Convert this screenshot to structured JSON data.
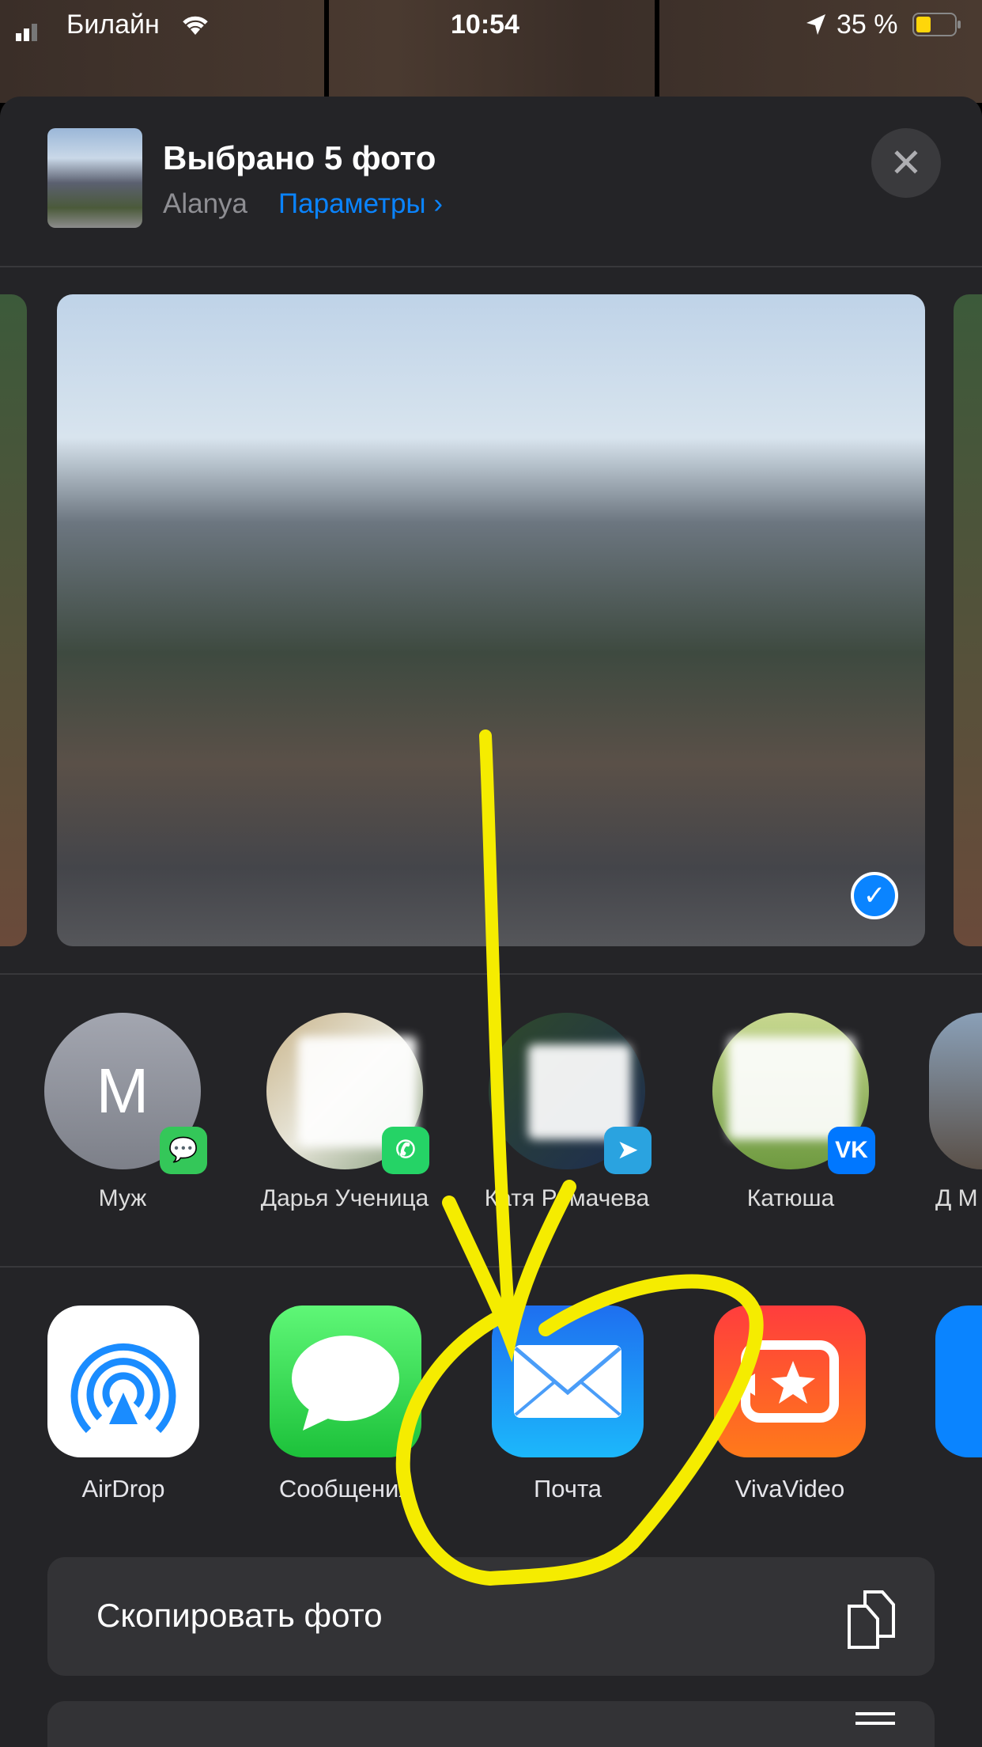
{
  "status_bar": {
    "carrier": "Билайн",
    "time": "10:54",
    "battery": "35 %",
    "icons": [
      "signal-icon",
      "wifi-icon",
      "location-icon",
      "battery-icon"
    ]
  },
  "header": {
    "title": "Выбрано 5 фото",
    "location": "Alanya",
    "options_label": "Параметры",
    "options_chevron": "›",
    "close_symbol": "✕"
  },
  "photo": {
    "selected": true,
    "check_symbol": "✓"
  },
  "contacts": [
    {
      "name": "Муж",
      "initial": "M",
      "app": "messages",
      "badge_color": "#34c759"
    },
    {
      "name": "Дарья Ученица",
      "app": "whatsapp",
      "badge_color": "#25d366"
    },
    {
      "name": "Катя Ромачева",
      "app": "telegram",
      "badge_color": "#2aa3e0"
    },
    {
      "name": "Катюша",
      "app": "vk",
      "badge_color": "#0077ff"
    },
    {
      "name": "Д М",
      "app": "unknown"
    }
  ],
  "apps": [
    {
      "label": "AirDrop",
      "icon": "airdrop-icon"
    },
    {
      "label": "Сообщения",
      "icon": "messages-icon"
    },
    {
      "label": "Почта",
      "icon": "mail-icon"
    },
    {
      "label": "VivaVideo",
      "icon": "vivavideo-icon"
    }
  ],
  "actions": [
    {
      "label": "Скопировать фото",
      "icon": "copy-icon"
    }
  ],
  "colors": {
    "accent": "#0a84ff",
    "annotation": "#f5ec00",
    "sheet": "#242427"
  }
}
